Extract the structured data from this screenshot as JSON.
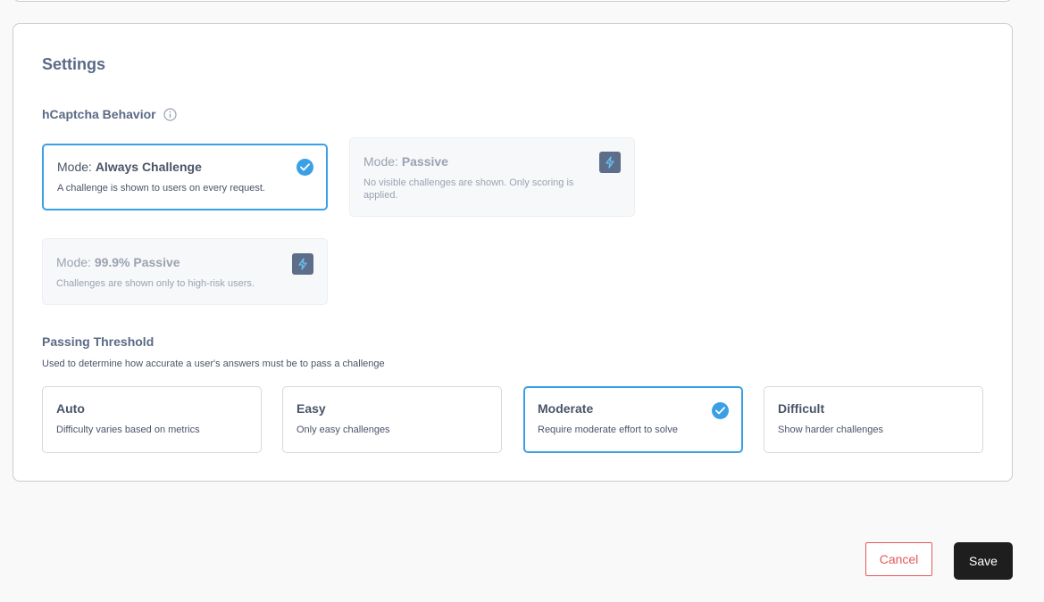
{
  "settings": {
    "title": "Settings",
    "behavior": {
      "label": "hCaptcha Behavior",
      "info_icon": "info-circle-icon",
      "modes": [
        {
          "prefix": "Mode:",
          "name": "Always Challenge",
          "description": "A challenge is shown to users on every request.",
          "state": "selected",
          "icon": "check-circle-icon"
        },
        {
          "prefix": "Mode:",
          "name": "Passive",
          "description": "No visible challenges are shown. Only scoring is applied.",
          "state": "disabled",
          "icon": "lightning-bolt-icon"
        },
        {
          "prefix": "Mode:",
          "name": "99.9% Passive",
          "description": "Challenges are shown only to high-risk users.",
          "state": "disabled",
          "icon": "lightning-bolt-icon"
        }
      ]
    },
    "threshold": {
      "label": "Passing Threshold",
      "description": "Used to determine how accurate a user's answers must be to pass a challenge",
      "options": [
        {
          "name": "Auto",
          "description": "Difficulty varies based on metrics",
          "selected": false
        },
        {
          "name": "Easy",
          "description": "Only easy challenges",
          "selected": false
        },
        {
          "name": "Moderate",
          "description": "Require moderate effort to solve",
          "selected": true
        },
        {
          "name": "Difficult",
          "description": "Show harder challenges",
          "selected": false
        }
      ]
    }
  },
  "actions": {
    "cancel_label": "Cancel",
    "save_label": "Save"
  },
  "colors": {
    "accent": "#3aa0e6",
    "cancel": "#e35a5a",
    "save_bg": "#1e1e1e",
    "badge_bg": "#5c6e8a"
  }
}
